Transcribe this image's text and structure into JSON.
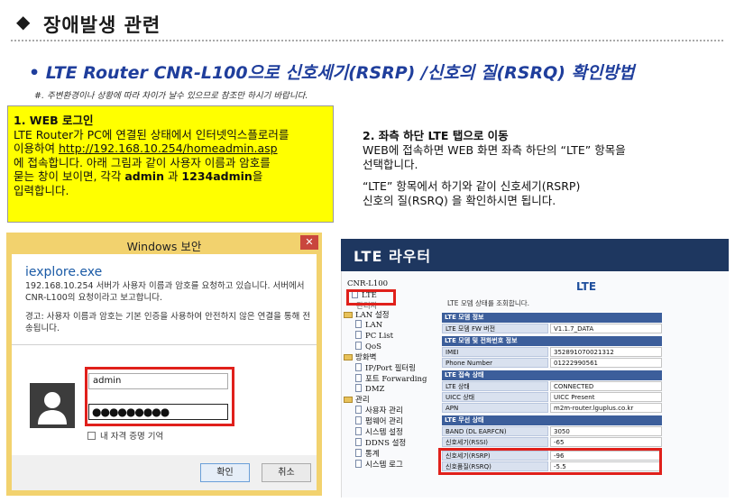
{
  "header": {
    "bullet": "◆",
    "title": "장애발생 관련"
  },
  "subtitle": "• LTE Router CNR-L100으로 신호세기(RSRP) /신호의 질(RSRQ) 확인방법",
  "note": "#. 주변환경이나 상황에 따라 차이가 날수 있으므로 참조만 하시기 바랍니다.",
  "step1": {
    "heading": "1. WEB 로그인",
    "line1": "LTE Router가 PC에 연결된 상태에서 인터넷익스플로러를",
    "line2_prefix": "이용하여 ",
    "url": "http://192.168.10.254/homeadmin.asp",
    "line3": "에 접속합니다. 아래 그림과 같이 사용자 이름과 암호를",
    "line4_prefix": "묻는 창이 보이면, 각각 ",
    "user": "admin",
    "line4_mid": " 과 ",
    "pass": "1234admin",
    "line4_suffix": "을",
    "line5": "입력합니다."
  },
  "step2": {
    "heading": "2. 좌측 하단 LTE 탭으로 이동",
    "line1": "WEB에 접속하면 WEB 화면 좌측 하단의 “LTE” 항목을",
    "line2": "선택합니다.",
    "line3": "“LTE” 항목에서 하기와 같이 신호세기(RSRP)",
    "line4": "신호의 질(RSRQ) 을 확인하시면 됩니다."
  },
  "dialog": {
    "title": "Windows 보안",
    "close": "✕",
    "app": "iexplore.exe",
    "message": "192.168.10.254 서버가 사용자 이름과 암호를 요청하고 있습니다. 서버에서 CNR-L100의 요청이라고 보고합니다.",
    "warning": "경고: 사용자 이름과 암호는 기본 인증을 사용하여 안전하지 않은 연결을 통해 전송됩니다.",
    "username_value": "admin",
    "password_mask": "●●●●●●●●●",
    "remember_label": "내 자격 증명 기억",
    "ok_label": "확인",
    "cancel_label": "취소"
  },
  "router": {
    "header_title": "LTE 라우터",
    "tree": {
      "root": "CNR-L100",
      "lte": "LTE",
      "hidden_item": "관리자",
      "lan_group": "LAN 설정",
      "lan": "LAN",
      "pc_list": "PC List",
      "qos": "QoS",
      "fw_group": "방화벽",
      "ip_port": "IP/Port 필터링",
      "port_fwd": "포트 Forwarding",
      "dmz": "DMZ",
      "admin_group": "관리",
      "user_mgmt": "사용자 관리",
      "firmware": "펌웨어 관리",
      "sys_settings": "시스템 설정",
      "ddns": "DDNS 설정",
      "stats": "통계",
      "sys_log": "시스템 로그"
    },
    "main_title": "LTE",
    "description": "LTE 모뎀 상태를 조회합니다.",
    "sections": [
      {
        "title": "LTE 모뎀 정보",
        "rows": [
          {
            "key": "LTE 모뎀 FW 버전",
            "value": "V1.1.7_DATA"
          }
        ]
      },
      {
        "title": "LTE 모뎀 및 전화번호 정보",
        "rows": [
          {
            "key": "IMEI",
            "value": "352891070021312"
          },
          {
            "key": "Phone Number",
            "value": "01222990561"
          }
        ]
      },
      {
        "title": "LTE 접속 상태",
        "rows": [
          {
            "key": "LTE 상태",
            "value": "CONNECTED"
          },
          {
            "key": "UICC 상태",
            "value": "UICC Present"
          },
          {
            "key": "APN",
            "value": "m2m-router.lguplus.co.kr"
          }
        ]
      },
      {
        "title": "LTE 무선 상태",
        "rows": [
          {
            "key": "BAND (DL EARFCN)",
            "value": "3050"
          },
          {
            "key": "신호세기(RSSI)",
            "value": "-65"
          },
          {
            "key": "신호세기(RSRP)",
            "value": "-96"
          },
          {
            "key": "신호품질(RSRQ)",
            "value": "-5.5"
          }
        ]
      }
    ]
  }
}
